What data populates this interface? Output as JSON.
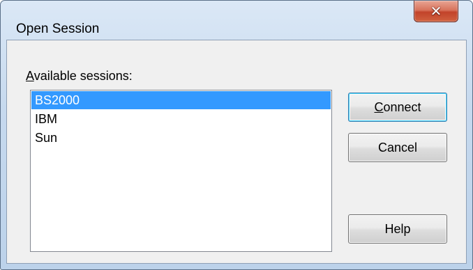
{
  "window": {
    "title": "Open Session",
    "close_glyph": "✕"
  },
  "sessions": {
    "label_accel": "A",
    "label_rest": "vailable sessions:",
    "items": [
      {
        "label": "BS2000",
        "selected": true
      },
      {
        "label": "IBM",
        "selected": false
      },
      {
        "label": "Sun",
        "selected": false
      }
    ]
  },
  "buttons": {
    "connect_accel": "C",
    "connect_rest": "onnect",
    "cancel": "Cancel",
    "help": "Help"
  },
  "colors": {
    "selection": "#3399ff",
    "close_button": "#c2432a"
  },
  "icons": {
    "close": "close-icon"
  }
}
